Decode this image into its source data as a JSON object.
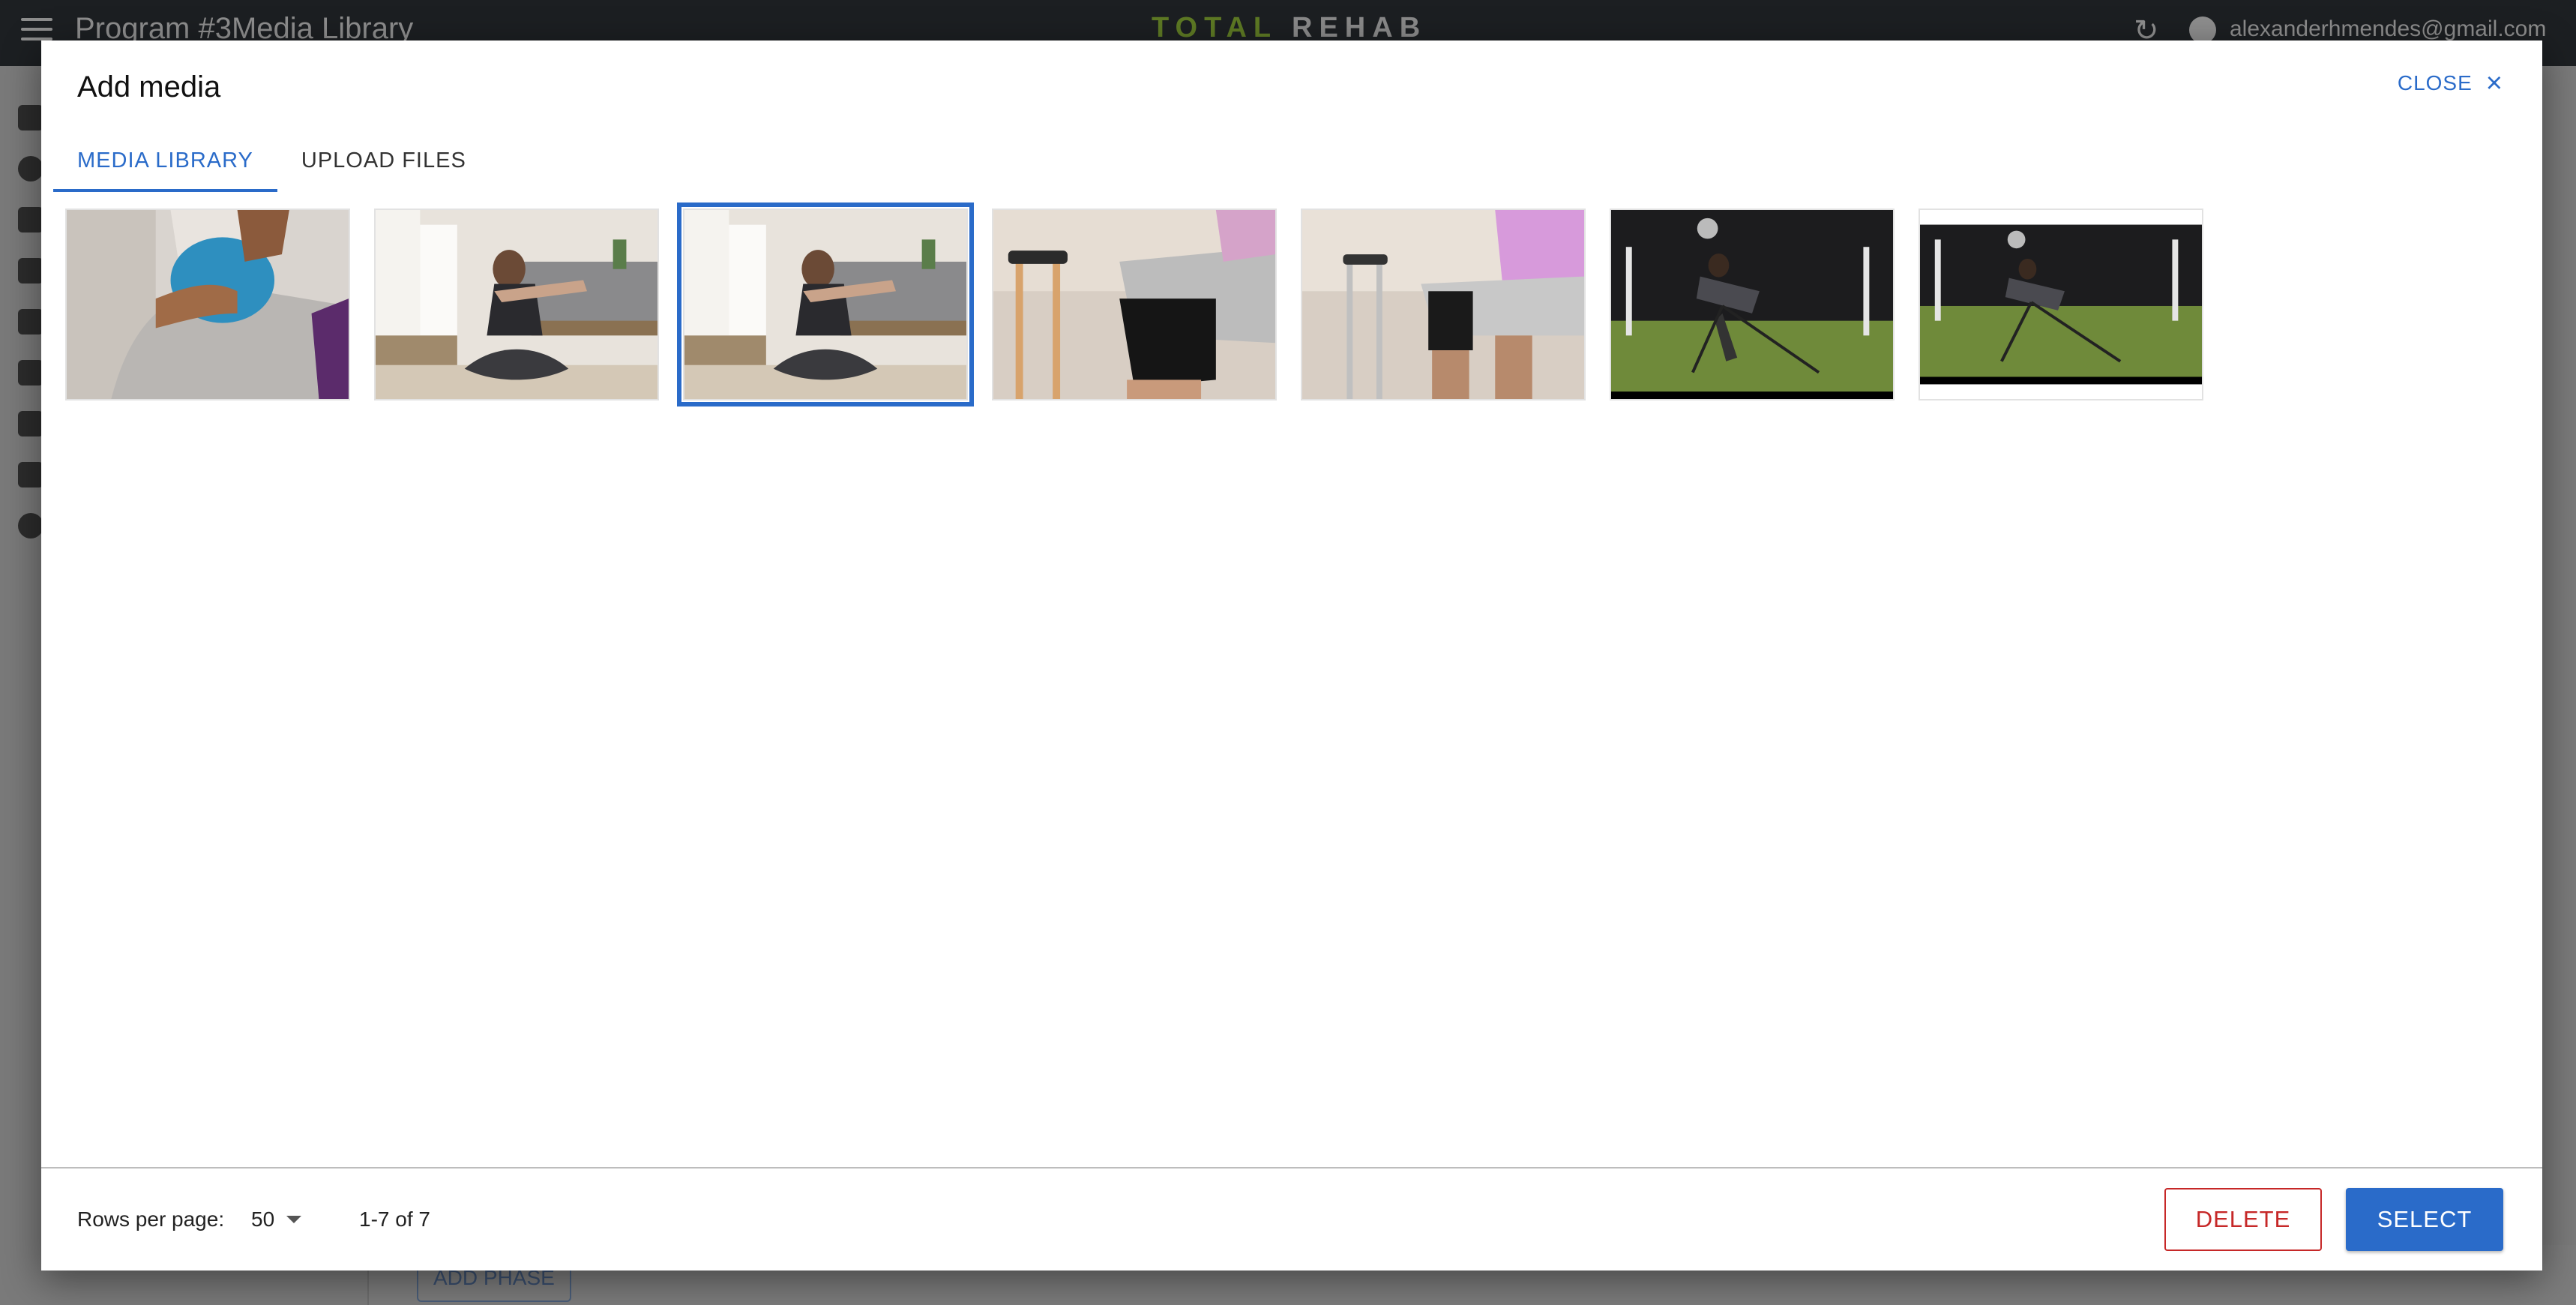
{
  "appbar": {
    "title": "Program #3Media Library",
    "brand_first": "TOTAL",
    "brand_second": "REHAB",
    "email": "alexanderhmendes@gmail.com"
  },
  "background": {
    "add_phase_label": "ADD PHASE"
  },
  "dialog": {
    "title": "Add media",
    "close_label": "CLOSE",
    "tabs": [
      {
        "label": "MEDIA LIBRARY",
        "active": true
      },
      {
        "label": "UPLOAD FILES",
        "active": false
      }
    ],
    "media": [
      {
        "subject": "ice pack on knee",
        "selected": false
      },
      {
        "subject": "woman stretching on floor",
        "selected": false
      },
      {
        "subject": "woman stretching on floor",
        "selected": true
      },
      {
        "subject": "knee brace with crutches",
        "selected": false
      },
      {
        "subject": "man with knee brace and crutches",
        "selected": false
      },
      {
        "subject": "gym cable exercise video",
        "selected": false
      },
      {
        "subject": "gym cable exercise video",
        "selected": false
      }
    ],
    "footer": {
      "rows_per_page_label": "Rows per page:",
      "rows_per_page_value": "50",
      "range": "1-7 of 7",
      "delete_label": "DELETE",
      "select_label": "SELECT"
    }
  },
  "colors": {
    "accent": "#2a6bc9",
    "danger": "#c62828",
    "appbar": "#1c1f22"
  }
}
